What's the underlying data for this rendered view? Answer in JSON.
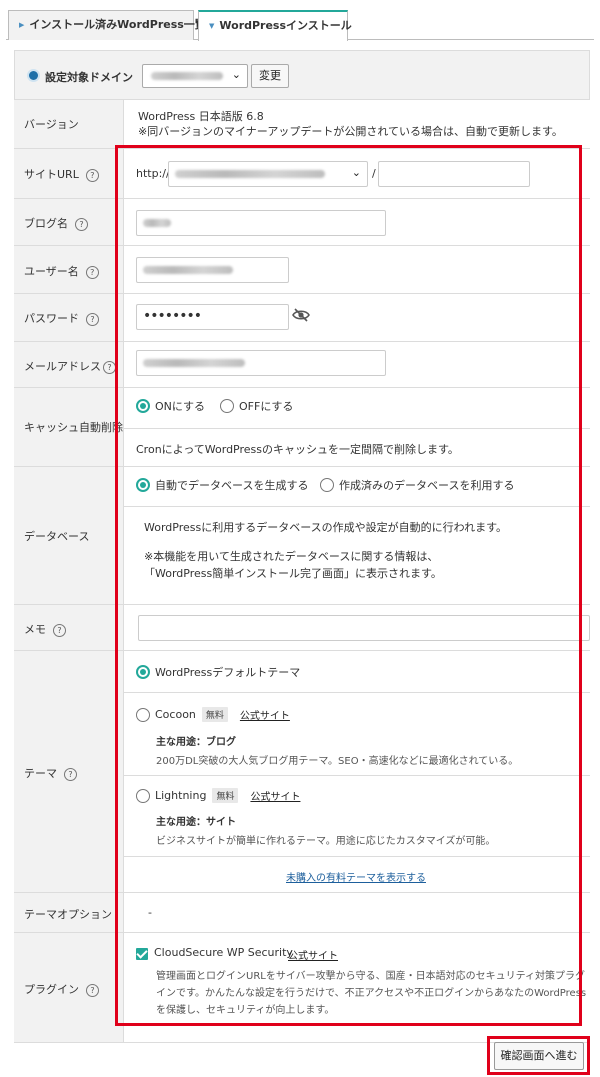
{
  "tabs": [
    {
      "label": "インストール済みWordPress一覧"
    },
    {
      "label": "WordPressインストール"
    }
  ],
  "domain": {
    "label": "設定対象ドメイン",
    "change_button": "変更"
  },
  "version": {
    "label": "バージョン",
    "value": "WordPress 日本語版 6.8",
    "note": "※同バージョンのマイナーアップデートが公開されている場合は、自動で更新します。"
  },
  "site_url": {
    "label": "サイトURL",
    "scheme": "http://",
    "separator": "/",
    "help": "?"
  },
  "blog_name": {
    "label": "ブログ名",
    "help": "?"
  },
  "username": {
    "label": "ユーザー名",
    "help": "?"
  },
  "password": {
    "label": "パスワード",
    "value": "••••••••",
    "help": "?"
  },
  "email": {
    "label": "メールアドレス",
    "help": "?"
  },
  "cache": {
    "label": "キャッシュ自動削除",
    "on": "ONにする",
    "off": "OFFにする",
    "note": "CronによってWordPressのキャッシュを一定間隔で削除します。"
  },
  "database": {
    "label": "データベース",
    "auto": "自動でデータベースを生成する",
    "existing": "作成済みのデータベースを利用する",
    "note1": "WordPressに利用するデータベースの作成や設定が自動的に行われます。",
    "note2": "※本機能を用いて生成されたデータベースに関する情報は、",
    "note3": "「WordPress簡単インストール完了画面」に表示されます。"
  },
  "memo": {
    "label": "メモ",
    "help": "?"
  },
  "theme": {
    "label": "テーマ",
    "help": "?",
    "default": "WordPressデフォルトテーマ",
    "cocoon": {
      "name": "Cocoon",
      "badge": "無料",
      "link": "公式サイト",
      "use": "主な用途：ブログ",
      "desc": "200万DL突破の大人気ブログ用テーマ。SEO・高速化などに最適化されている。"
    },
    "lightning": {
      "name": "Lightning",
      "badge": "無料",
      "link": "公式サイト",
      "use": "主な用途：サイト",
      "desc": "ビジネスサイトが簡単に作れるテーマ。用途に応じたカスタマイズが可能。"
    },
    "paid_link": "未購入の有料テーマを表示する"
  },
  "theme_option": {
    "label": "テーマオプション",
    "value": "-"
  },
  "plugin": {
    "label": "プラグイン",
    "help": "?",
    "name": "CloudSecure WP Security",
    "link": "公式サイト",
    "desc1": "管理画面とログインURLをサイバー攻撃から守る、国産・日本語対応のセキュリティ対策プラグ",
    "desc2": "インです。かんたんな設定を行うだけで、不正アクセスや不正ログインからあなたのWordPress",
    "desc3": "を保護し、セキュリティが向上します。"
  },
  "next_button": "確認画面へ進む",
  "colors": {
    "accent": "#23a89a",
    "highlight": "#e0001a",
    "link": "#1d5f9c"
  }
}
